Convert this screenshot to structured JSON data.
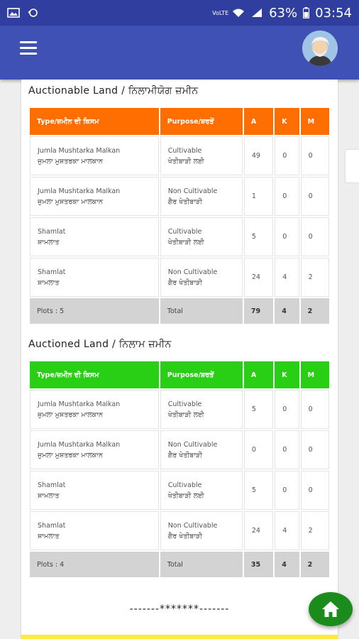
{
  "status_bar": {
    "battery": "63%",
    "time": "03:54",
    "volte": "VoLTE"
  },
  "colors": {
    "app_bar": "#3f51b5",
    "status_bar": "#303f9f",
    "auctionable_header": "#ff6e00",
    "auctioned_header": "#29cf15",
    "fab": "#1b8c1b"
  },
  "headers": {
    "type": "Type/ਜ਼ਮੀਨ ਦੀ ਕਿਸਮ",
    "purpose": "Purpose/ਸ਼ਰਤੇਂ",
    "a": "A",
    "k": "K",
    "m": "M"
  },
  "auctionable": {
    "title": "Auctionable Land / ਨਿਲਾਮੀਯੋਗ ਜ਼ਮੀਨ",
    "rows": [
      {
        "type_en": "Jumla Mushtarka Malkan",
        "type_pa": "ਜੁਮਲਾ ਮੁਸ਼ਤਰਕਾ ਮਾਲਕਾਨ",
        "purpose_en": "Cultivable",
        "purpose_pa": "ਖੇਤੀਬਾੜੀ ਲਈ",
        "a": "49",
        "k": "0",
        "m": "0"
      },
      {
        "type_en": "Jumla Mushtarka Malkan",
        "type_pa": "ਜੁਮਲਾ ਮੁਸ਼ਤਰਕਾ ਮਾਲਕਾਨ",
        "purpose_en": "Non Cultivable",
        "purpose_pa": "ਗੈਰ ਖੇਤੀਬਾੜੀ",
        "a": "1",
        "k": "0",
        "m": "0"
      },
      {
        "type_en": "Shamlat",
        "type_pa": "ਸ਼ਾਮਲਾਤ",
        "purpose_en": "Cultivable",
        "purpose_pa": "ਖੇਤੀਬਾੜੀ ਲਈ",
        "a": "5",
        "k": "0",
        "m": "0"
      },
      {
        "type_en": "Shamlat",
        "type_pa": "ਸ਼ਾਮਲਾਤ",
        "purpose_en": "Non Cultivable",
        "purpose_pa": "ਗੈਰ ਖੇਤੀਬਾੜੀ",
        "a": "24",
        "k": "4",
        "m": "2"
      }
    ],
    "total": {
      "plots": "Plots : 5",
      "label": "Total",
      "a": "79",
      "k": "4",
      "m": "2"
    }
  },
  "auctioned": {
    "title": "Auctioned Land / ਨਿਲਾਮ ਜ਼ਮੀਨ",
    "rows": [
      {
        "type_en": "Jumla Mushtarka Malkan",
        "type_pa": "ਜੁਮਲਾ ਮੁਸ਼ਤਰਕਾ ਮਾਲਕਾਨ",
        "purpose_en": "Cultivable",
        "purpose_pa": "ਖੇਤੀਬਾੜੀ ਲਈ",
        "a": "5",
        "k": "0",
        "m": "0"
      },
      {
        "type_en": "Jumla Mushtarka Malkan",
        "type_pa": "ਜੁਮਲਾ ਮੁਸ਼ਤਰਕਾ ਮਾਲਕਾਨ",
        "purpose_en": "Non Cultivable",
        "purpose_pa": "ਗੈਰ ਖੇਤੀਬਾੜੀ",
        "a": "0",
        "k": "0",
        "m": "0"
      },
      {
        "type_en": "Shamlat",
        "type_pa": "ਸ਼ਾਮਲਾਤ",
        "purpose_en": "Cultivable",
        "purpose_pa": "ਖੇਤੀਬਾੜੀ ਲਈ",
        "a": "5",
        "k": "0",
        "m": "0"
      },
      {
        "type_en": "Shamlat",
        "type_pa": "ਸ਼ਾਮਲਾਤ",
        "purpose_en": "Non Cultivable",
        "purpose_pa": "ਗੈਰ ਖੇਤੀਬਾੜੀ",
        "a": "24",
        "k": "4",
        "m": "2"
      }
    ],
    "total": {
      "plots": "Plots : 4",
      "label": "Total",
      "a": "35",
      "k": "4",
      "m": "2"
    }
  },
  "footer": {
    "divider_text": "-------*******-------"
  },
  "icons": {
    "menu": "hamburger-menu-icon",
    "avatar": "user-avatar",
    "home": "home-icon"
  }
}
